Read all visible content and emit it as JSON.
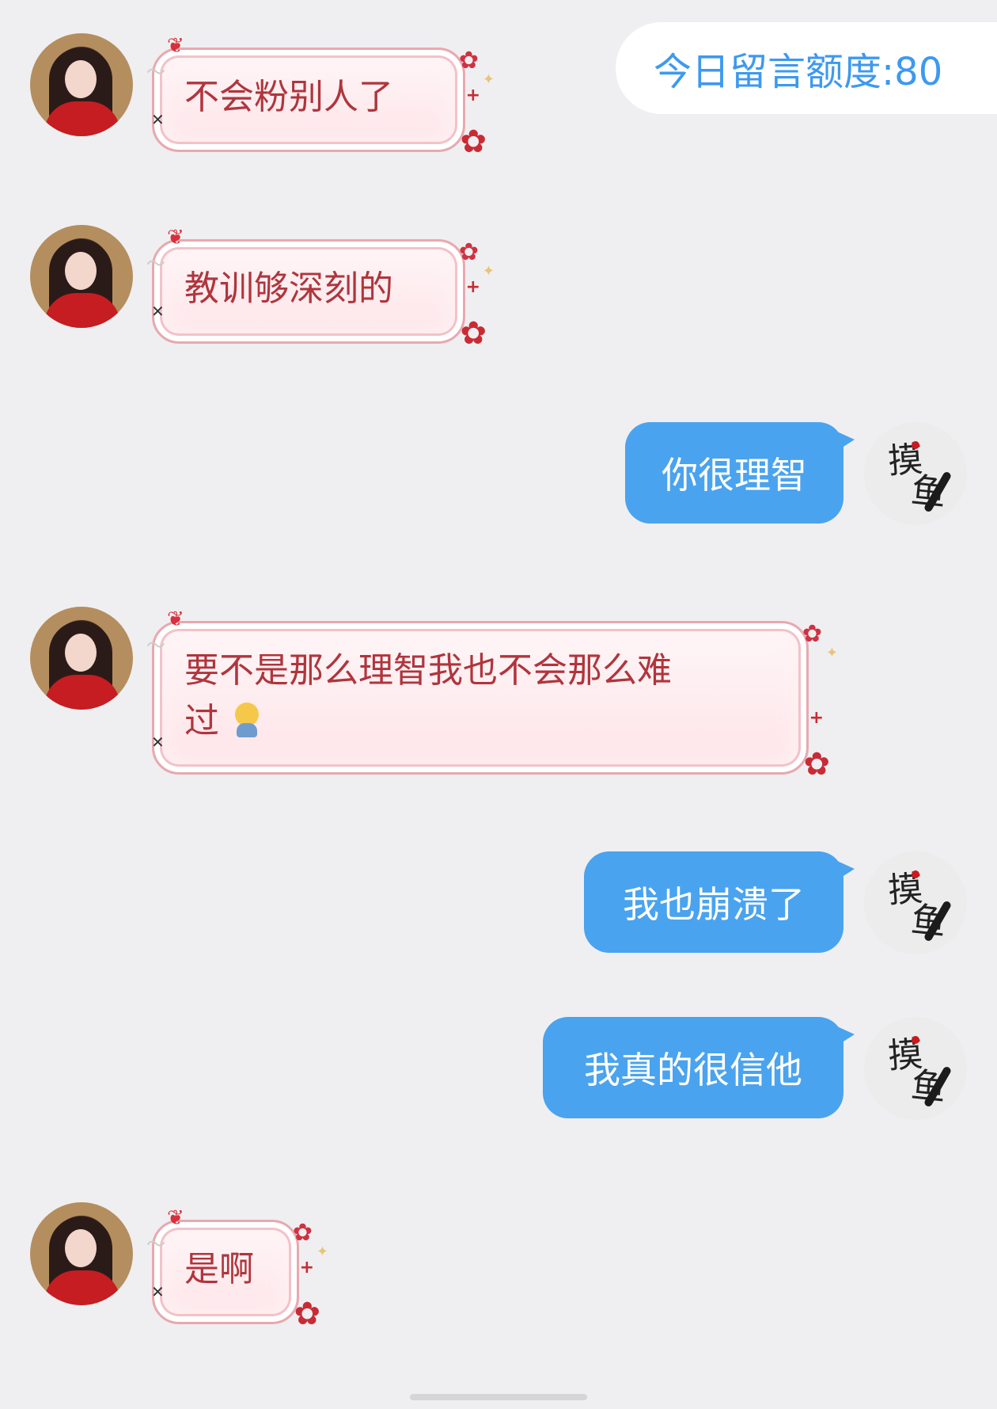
{
  "quota": {
    "label": "今日留言额度:80"
  },
  "messages": [
    {
      "text": "不会粉别人了"
    },
    {
      "text": "教训够深刻的"
    },
    {
      "text": "你很理智"
    },
    {
      "text": "要不是那么理智我也不会那么难"
    },
    {
      "text": "过"
    },
    {
      "text": "我也崩溃了"
    },
    {
      "text": "我真的很信他"
    },
    {
      "text": "是啊"
    }
  ],
  "me_avatar": {
    "glyph1": "摸",
    "glyph2": "鱼"
  },
  "colors": {
    "background": "#efeff1",
    "quota_text": "#3d99f0",
    "blue_bubble": "#4aa3ef",
    "pink_text": "#b0353d"
  }
}
